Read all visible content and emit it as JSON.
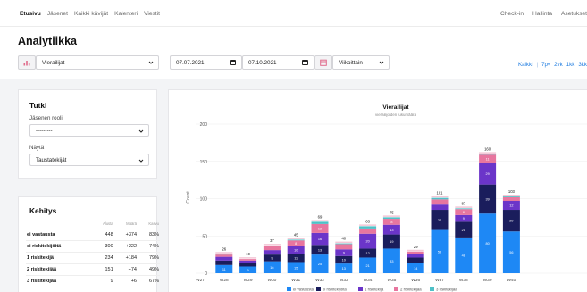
{
  "nav": {
    "left": [
      "Etusivu",
      "Jäsenet",
      "Kaikki kävijät",
      "Kalenteri",
      "Viestit"
    ],
    "right": [
      "Check-in",
      "Hallinta",
      "Asetukset"
    ]
  },
  "page_title": "Analytiikka",
  "toolbar": {
    "metric_select": "Vierailijat",
    "date_from": "07.07.2021",
    "date_to": "07.10.2021",
    "grouping_select": "Viikoittain",
    "period_links": [
      "Kaikki",
      "|",
      "7pv",
      "2vk",
      "1kk",
      "3kk"
    ]
  },
  "tutki": {
    "title": "Tutki",
    "role_label": "Jäsenen rooli",
    "role_value": "---------",
    "show_label": "Näytä",
    "show_value": "Taustatekijät"
  },
  "kehitys": {
    "title": "Kehitys",
    "headers": [
      "",
      "Alusta",
      "Määrä",
      "Kasvu"
    ],
    "rows": [
      [
        "ei vastausta",
        "448",
        "+374",
        "83%"
      ],
      [
        "ei riskitekijöitä",
        "300",
        "+222",
        "74%"
      ],
      [
        "1 riskitekijä",
        "234",
        "+184",
        "79%"
      ],
      [
        "2 riskitekijää",
        "151",
        "+74",
        "49%"
      ],
      [
        "3 riskitekijää",
        "9",
        "+6",
        "67%"
      ]
    ]
  },
  "colors": {
    "accent": "#1d7be0",
    "series": [
      "#1e88f5",
      "#1a1d5c",
      "#6b35c9",
      "#e8769f",
      "#4fc1c7"
    ]
  },
  "chart_data": {
    "type": "bar",
    "stacked": true,
    "title": "Vierailijat",
    "subtitle": "vierailijoiden lukumäärä",
    "xlabel": "",
    "ylabel": "Count",
    "ylim": [
      0,
      200
    ],
    "yticks": [
      0,
      50,
      100,
      150,
      200
    ],
    "categories": [
      "W27",
      "W28",
      "W29",
      "W30",
      "W31",
      "W32",
      "W33",
      "W34",
      "W35",
      "W36",
      "W37",
      "W38",
      "W39",
      "W40"
    ],
    "totals": [
      0,
      26,
      19,
      37,
      45,
      69,
      40,
      63,
      75,
      29,
      101,
      87,
      160,
      103
    ],
    "series": [
      {
        "name": "ei vastausta",
        "values": [
          0,
          11,
          9,
          16,
          15,
          25,
          13,
          21,
          33,
          14,
          58,
          48,
          80,
          56
        ]
      },
      {
        "name": "ei riskitekijöitä",
        "values": [
          0,
          6,
          5,
          9,
          11,
          13,
          10,
          12,
          19,
          7,
          27,
          21,
          39,
          29
        ]
      },
      {
        "name": "1 riskitekijä",
        "values": [
          0,
          5,
          3,
          6,
          10,
          16,
          9,
          20,
          13,
          5,
          7,
          9,
          29,
          12
        ]
      },
      {
        "name": "2 riskitekijää",
        "values": [
          0,
          3,
          2,
          5,
          8,
          12,
          7,
          7,
          8,
          3,
          7,
          8,
          11,
          5
        ]
      },
      {
        "name": "3 riskitekijää",
        "values": [
          0,
          1,
          0,
          1,
          1,
          3,
          1,
          3,
          2,
          0,
          2,
          1,
          1,
          1
        ]
      }
    ],
    "legend_position": "bottom"
  }
}
